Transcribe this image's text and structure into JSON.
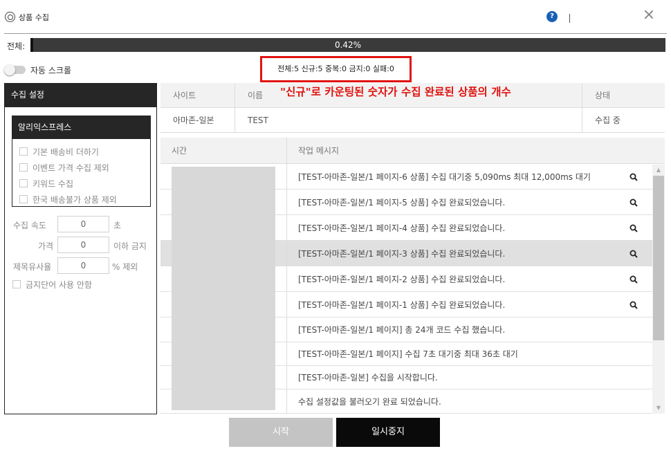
{
  "window": {
    "title": "상품 수집",
    "help_label": "?"
  },
  "progress": {
    "label": "전체:",
    "value_text": "0.42%",
    "fraction": 0.0042
  },
  "auto_scroll": {
    "label": "자동 스크롤",
    "enabled": false
  },
  "stats": {
    "text": "전체:5 신규:5 중복:0 금지:0 실패:0"
  },
  "annotation": {
    "text": "\"신규\"로 카운팅된 숫자가 수집 완료된 상품의 개수",
    "color": "#e0120f"
  },
  "settings": {
    "header": "수집 설정",
    "aliexpress": {
      "header": "알리익스프레스",
      "options": [
        "기본 배송비 더하기",
        "이벤트 가격 수집 제외",
        "키워드 수집",
        "한국 배송불가 상품 제외"
      ]
    },
    "speed": {
      "label": "수집 속도",
      "value": "0",
      "unit": "초"
    },
    "price": {
      "label": "가격",
      "value": "0",
      "unit": "이하 금지"
    },
    "similarity": {
      "label": "제목유사율",
      "value": "0",
      "unit": "% 제외"
    },
    "no_banned_words": "금지단어 사용 안함"
  },
  "site_table": {
    "headers": {
      "site": "사이트",
      "name": "이름",
      "status": "상태"
    },
    "row": {
      "site": "아마존-일본",
      "name": "TEST",
      "status": "수집 중"
    }
  },
  "log_table": {
    "headers": {
      "time": "시간",
      "message": "작업 메시지"
    },
    "rows": [
      {
        "message": "[TEST-아마존-일본/1 페이지-6 상품] 수집 대기중 5,090ms 최대 12,000ms 대기",
        "search": true
      },
      {
        "message": "[TEST-아마존-일본/1 페이지-5 상품] 수집 완료되었습니다.",
        "search": true
      },
      {
        "message": "[TEST-아마존-일본/1 페이지-4 상품] 수집 완료되었습니다.",
        "search": true
      },
      {
        "message": "[TEST-아마존-일본/1 페이지-3 상품] 수집 완료되었습니다.",
        "search": true
      },
      {
        "message": "[TEST-아마존-일본/1 페이지-2 상품] 수집 완료되었습니다.",
        "search": true
      },
      {
        "message": "[TEST-아마존-일본/1 페이지-1 상품] 수집 완료되었습니다.",
        "search": true
      },
      {
        "message": "[TEST-아마존-일본/1 페이지] 총 24개 코드 수집 했습니다.",
        "search": false
      },
      {
        "message": "[TEST-아마존-일본/1 페이지] 수집 7초 대기중 최대 36초 대기",
        "search": false
      },
      {
        "message": "[TEST-아마존-일본] 수집을 시작합니다.",
        "search": false
      },
      {
        "message": "수집 설정값을 불러오기 완료 되었습니다.",
        "search": false
      }
    ]
  },
  "buttons": {
    "start": "시작",
    "pause": "일시중지"
  }
}
